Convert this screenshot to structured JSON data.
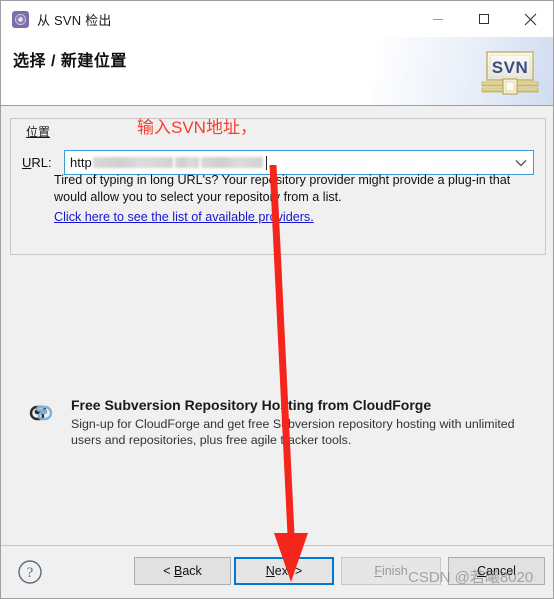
{
  "window": {
    "title": "从 SVN 检出",
    "icon": "svn-app-icon",
    "controls": {
      "minimize": "minimize-icon",
      "maximize": "maximize-icon",
      "close": "close-icon"
    }
  },
  "header": {
    "title": "选择 / 新建位置",
    "logo_text": "SVN",
    "logo_name": "svn-certificate-logo"
  },
  "location_group": {
    "legend": "位置",
    "url_label": "URL:",
    "url_value_prefix": "http",
    "url_value_redacted": true,
    "url_dropdown_icon": "chevron-down-icon",
    "description": "Tired of typing in long URL's?  Your repository provider might provide a plug-in that would allow you to select your repository from a list.",
    "link_text": "Click here to see the list of available providers."
  },
  "promo": {
    "icon": "cloudforge-clouds-icon",
    "title": "Free Subversion Repository Hosting from CloudForge",
    "body": "Sign-up for CloudForge and get free Subversion repository hosting with unlimited users and repositories, plus free agile tracker tools."
  },
  "footer": {
    "help_icon": "help-question-icon",
    "buttons": [
      {
        "id": "back",
        "label": "< Back",
        "mnemonic": "B",
        "enabled": true,
        "focused": false
      },
      {
        "id": "next",
        "label": "Next >",
        "mnemonic": "N",
        "enabled": true,
        "focused": true
      },
      {
        "id": "finish",
        "label": "Finish",
        "mnemonic": "F",
        "enabled": false,
        "focused": false
      },
      {
        "id": "cancel",
        "label": "Cancel",
        "mnemonic": "C",
        "enabled": true,
        "focused": false
      }
    ],
    "back_label_pre": "< ",
    "back_label_mn": "B",
    "back_label_post": "ack",
    "next_label_mn": "N",
    "next_label_post": "ext >",
    "finish_label_mn": "F",
    "finish_label_post": "inish",
    "cancel_label_pre": "",
    "cancel_label_mn": "C",
    "cancel_label_post": "ancel"
  },
  "annotations": {
    "instruction_text": "输入SVN地址，",
    "arrow_color": "#f4251b",
    "arrow_name": "red-arrow-to-next-button"
  },
  "watermark": {
    "text": "CSDN @若曦8020"
  },
  "colors": {
    "accent_focus": "#0078d7",
    "link": "#1515cf",
    "annotation_red": "#fb3b30",
    "dialog_bg": "#f0f0f0",
    "header_bg": "#ffffff"
  }
}
